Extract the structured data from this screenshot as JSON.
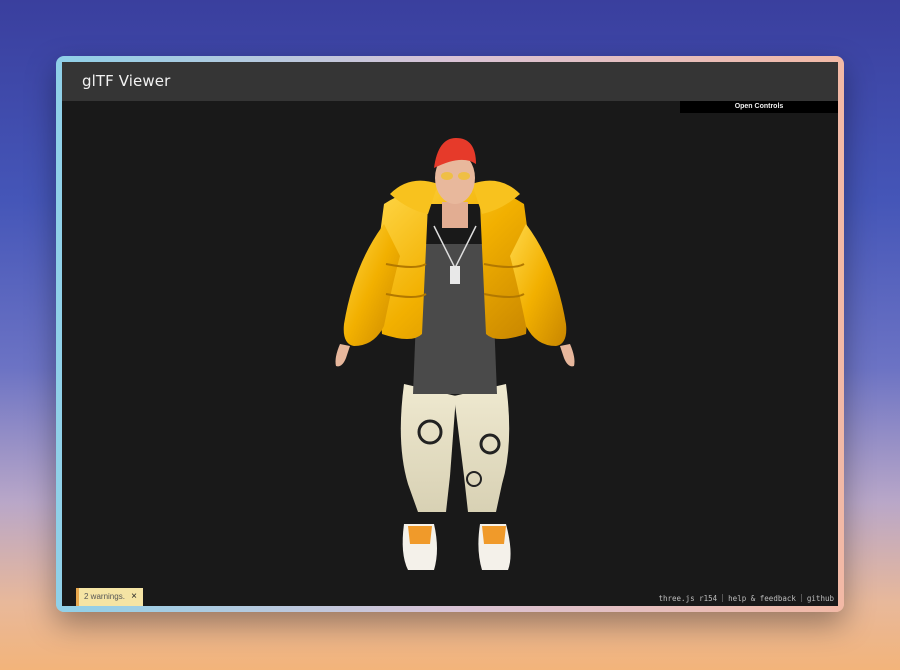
{
  "app": {
    "title": "glTF Viewer"
  },
  "controls": {
    "open_label": "Open Controls"
  },
  "warnings": {
    "text": "2 warnings.",
    "close_glyph": "×"
  },
  "footer": {
    "links": [
      "three.js r154",
      "help & feedback",
      "github"
    ]
  },
  "colors": {
    "background_top": "#3a3f9e",
    "background_bottom": "#f3b47a",
    "titlebar": "#353535",
    "viewport": "#191919",
    "warning_bg": "#f5e4a4",
    "jacket": "#f2b000"
  }
}
